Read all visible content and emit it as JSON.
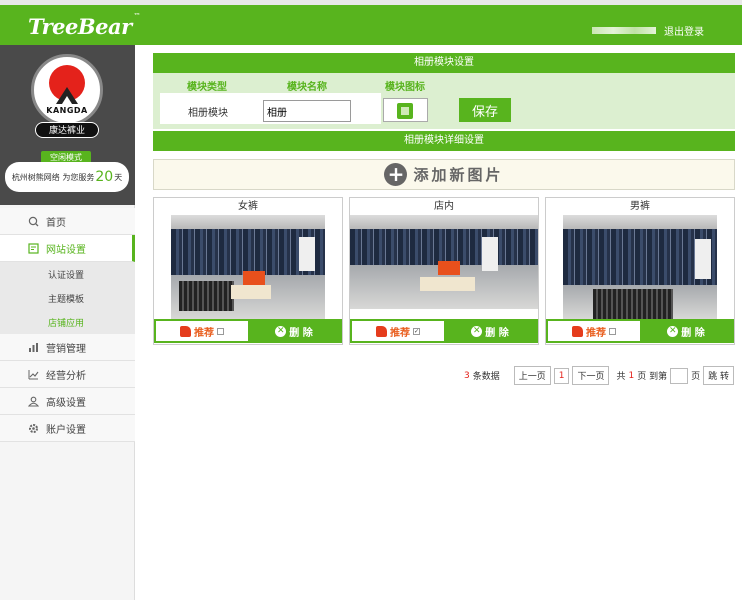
{
  "header": {
    "logo_text": "TreeBear",
    "logo_mark": "™",
    "logout_label": "退出登录"
  },
  "sidebar": {
    "brand_name": "KANGDA",
    "company_name": "康达裤业",
    "mode_label": "空闲模式",
    "service_prefix": "杭州树熊网络 为您服务",
    "service_days": "20",
    "service_suffix": "天",
    "nav": [
      {
        "label": "首页",
        "icon": "search-icon"
      },
      {
        "label": "网站设置",
        "icon": "settings-page-icon",
        "active": true
      },
      {
        "label": "营销管理",
        "icon": "bar-chart-icon"
      },
      {
        "label": "经营分析",
        "icon": "analysis-icon"
      },
      {
        "label": "高级设置",
        "icon": "user-icon"
      },
      {
        "label": "账户设置",
        "icon": "gear-icon"
      }
    ],
    "subnav": [
      {
        "label": "认证设置"
      },
      {
        "label": "主题模板"
      },
      {
        "label": "店铺应用",
        "active": true
      }
    ]
  },
  "module": {
    "settings_title": "相册模块设置",
    "col_type": "模块类型",
    "col_name": "模块名称",
    "col_icon": "模块图标",
    "type_value": "相册模块",
    "name_value": "相册",
    "save_label": "保存",
    "detail_title": "相册模块详细设置",
    "add_label": "添加新图片"
  },
  "albums": [
    {
      "title": "女裤",
      "recommend_label": "推荐",
      "recommended": false,
      "delete_label": "删 除"
    },
    {
      "title": "店内",
      "recommend_label": "推荐",
      "recommended": true,
      "delete_label": "删 除"
    },
    {
      "title": "男裤",
      "recommend_label": "推荐",
      "recommended": false,
      "delete_label": "删 除"
    }
  ],
  "pager": {
    "count": "3",
    "count_suffix": "条数据",
    "prev": "上一页",
    "current": "1",
    "next": "下一页",
    "total_prefix": "共",
    "total_pages": "1",
    "total_suffix": "页 到第",
    "page_suffix": "页",
    "go": "跳 转"
  },
  "colors": {
    "brand_green": "#58b41e",
    "accent_red": "#e4221b"
  }
}
